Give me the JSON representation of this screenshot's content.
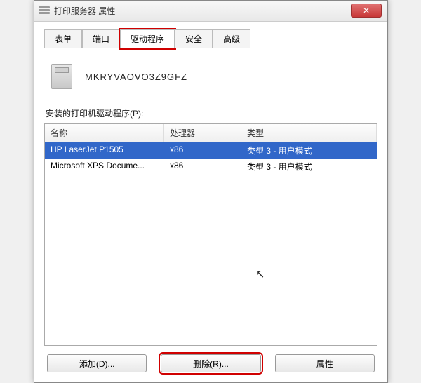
{
  "window": {
    "title": "打印服务器 属性",
    "close_symbol": "✕"
  },
  "tabs": [
    {
      "label": "表单",
      "active": false
    },
    {
      "label": "端口",
      "active": false
    },
    {
      "label": "驱动程序",
      "active": true,
      "highlighted": true
    },
    {
      "label": "安全",
      "active": false
    },
    {
      "label": "高级",
      "active": false
    }
  ],
  "server_name": "MKRYVAOVO3Z9GFZ",
  "section_label": "安装的打印机驱动程序(P):",
  "columns": {
    "name": "名称",
    "processor": "处理器",
    "type": "类型"
  },
  "rows": [
    {
      "name": "HP LaserJet P1505",
      "processor": "x86",
      "type": "类型 3 - 用户模式",
      "selected": true
    },
    {
      "name": "Microsoft XPS Docume...",
      "processor": "x86",
      "type": "类型 3 - 用户模式",
      "selected": false
    }
  ],
  "buttons": {
    "add": "添加(D)...",
    "remove": "删除(R)...",
    "properties": "属性"
  }
}
